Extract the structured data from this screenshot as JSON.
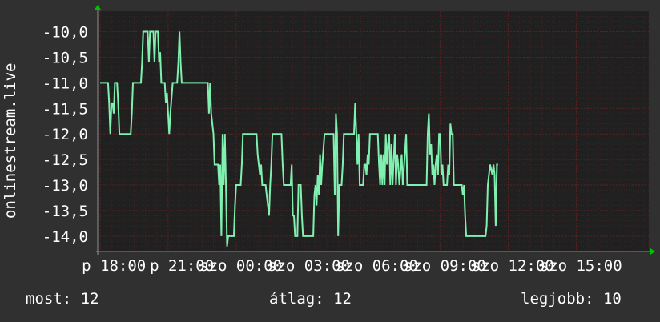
{
  "chart_data": {
    "type": "line",
    "ylabel": "onlinestream.live",
    "ylim": [
      -14.3,
      -9.6
    ],
    "y_ticks": [
      "-10,0",
      "-10,5",
      "-11,0",
      "-11,5",
      "-12,0",
      "-12,5",
      "-13,0",
      "-13,5",
      "-14,0"
    ],
    "y_tick_values": [
      -10,
      -10.5,
      -11,
      -11.5,
      -12,
      -12.5,
      -13,
      -13.5,
      -14
    ],
    "x_ticks": [
      "p 18:00",
      "p 21:00",
      "szo 00:00",
      "szo 03:00",
      "szo 06:00",
      "szo 09:00",
      "szo 12:00",
      "szo 15:00"
    ],
    "x_tick_hours": [
      0,
      3,
      6,
      9,
      12,
      15,
      18,
      21
    ],
    "xlim_hours": [
      0,
      24.2
    ],
    "grid": true,
    "colors": {
      "line": "#80f0b0",
      "background": "#303030",
      "plot_bg": "#202020",
      "grid": "#5a1f1f",
      "arrow": "#00c000"
    },
    "series": [
      {
        "values": [
          [
            0.0,
            -11.0
          ],
          [
            0.35,
            -11.0
          ],
          [
            0.4,
            -11.4
          ],
          [
            0.45,
            -12.0
          ],
          [
            0.5,
            -11.4
          ],
          [
            0.55,
            -11.4
          ],
          [
            0.6,
            -11.6
          ],
          [
            0.65,
            -11.0
          ],
          [
            0.75,
            -11.0
          ],
          [
            0.8,
            -11.4
          ],
          [
            0.85,
            -12.0
          ],
          [
            1.35,
            -12.0
          ],
          [
            1.4,
            -11.6
          ],
          [
            1.45,
            -11.0
          ],
          [
            1.8,
            -11.0
          ],
          [
            1.85,
            -10.6
          ],
          [
            1.9,
            -10.0
          ],
          [
            2.1,
            -10.0
          ],
          [
            2.15,
            -10.6
          ],
          [
            2.2,
            -10.0
          ],
          [
            2.35,
            -10.0
          ],
          [
            2.4,
            -10.6
          ],
          [
            2.45,
            -10.0
          ],
          [
            2.55,
            -10.0
          ],
          [
            2.6,
            -10.6
          ],
          [
            2.65,
            -10.4
          ],
          [
            2.7,
            -11.0
          ],
          [
            2.85,
            -11.0
          ],
          [
            2.9,
            -11.4
          ],
          [
            2.95,
            -11.2
          ],
          [
            3.0,
            -11.6
          ],
          [
            3.05,
            -12.0
          ],
          [
            3.1,
            -11.6
          ],
          [
            3.2,
            -11.0
          ],
          [
            3.4,
            -11.0
          ],
          [
            3.45,
            -10.6
          ],
          [
            3.5,
            -10.0
          ],
          [
            3.55,
            -10.6
          ],
          [
            3.6,
            -11.0
          ],
          [
            4.75,
            -11.0
          ],
          [
            4.8,
            -11.6
          ],
          [
            4.85,
            -11.0
          ],
          [
            4.9,
            -11.6
          ],
          [
            5.0,
            -12.0
          ],
          [
            5.05,
            -12.6
          ],
          [
            5.2,
            -12.6
          ],
          [
            5.25,
            -13.0
          ],
          [
            5.3,
            -12.6
          ],
          [
            5.35,
            -14.0
          ],
          [
            5.4,
            -12.0
          ],
          [
            5.45,
            -13.0
          ],
          [
            5.5,
            -12.0
          ],
          [
            5.55,
            -13.0
          ],
          [
            5.6,
            -14.2
          ],
          [
            5.65,
            -14.0
          ],
          [
            5.9,
            -14.0
          ],
          [
            5.95,
            -13.4
          ],
          [
            6.0,
            -13.0
          ],
          [
            6.2,
            -13.0
          ],
          [
            6.25,
            -12.6
          ],
          [
            6.3,
            -12.0
          ],
          [
            6.9,
            -12.0
          ],
          [
            6.95,
            -12.4
          ],
          [
            7.0,
            -12.6
          ],
          [
            7.05,
            -12.8
          ],
          [
            7.1,
            -12.6
          ],
          [
            7.15,
            -13.0
          ],
          [
            7.3,
            -13.0
          ],
          [
            7.35,
            -13.2
          ],
          [
            7.4,
            -13.4
          ],
          [
            7.45,
            -13.6
          ],
          [
            7.5,
            -13.0
          ],
          [
            7.55,
            -12.6
          ],
          [
            7.6,
            -12.0
          ],
          [
            8.0,
            -12.0
          ],
          [
            8.05,
            -12.6
          ],
          [
            8.1,
            -13.0
          ],
          [
            8.4,
            -13.0
          ],
          [
            8.45,
            -12.6
          ],
          [
            8.5,
            -13.6
          ],
          [
            8.55,
            -13.6
          ],
          [
            8.6,
            -14.0
          ],
          [
            8.7,
            -14.0
          ],
          [
            8.75,
            -13.0
          ],
          [
            8.85,
            -13.0
          ],
          [
            8.9,
            -13.6
          ],
          [
            8.95,
            -14.0
          ],
          [
            9.4,
            -14.0
          ],
          [
            9.45,
            -13.2
          ],
          [
            9.5,
            -13.0
          ],
          [
            9.55,
            -13.4
          ],
          [
            9.6,
            -12.8
          ],
          [
            9.65,
            -13.2
          ],
          [
            9.7,
            -12.4
          ],
          [
            9.75,
            -13.0
          ],
          [
            9.8,
            -12.6
          ],
          [
            9.9,
            -12.0
          ],
          [
            10.3,
            -12.0
          ],
          [
            10.35,
            -13.2
          ],
          [
            10.4,
            -11.6
          ],
          [
            10.45,
            -12.0
          ],
          [
            10.5,
            -14.0
          ],
          [
            10.55,
            -13.0
          ],
          [
            10.65,
            -13.0
          ],
          [
            10.7,
            -12.6
          ],
          [
            10.75,
            -12.0
          ],
          [
            11.2,
            -12.0
          ],
          [
            11.25,
            -11.4
          ],
          [
            11.3,
            -12.0
          ],
          [
            11.35,
            -12.6
          ],
          [
            11.4,
            -12.0
          ],
          [
            11.45,
            -13.0
          ],
          [
            11.6,
            -13.0
          ],
          [
            11.65,
            -12.6
          ],
          [
            11.7,
            -12.6
          ],
          [
            11.75,
            -12.8
          ],
          [
            11.8,
            -12.4
          ],
          [
            11.85,
            -12.6
          ],
          [
            11.9,
            -12.0
          ],
          [
            12.25,
            -12.0
          ],
          [
            12.3,
            -12.6
          ],
          [
            12.35,
            -13.0
          ],
          [
            12.4,
            -12.4
          ],
          [
            12.45,
            -13.0
          ],
          [
            12.5,
            -12.4
          ],
          [
            12.55,
            -13.0
          ],
          [
            12.6,
            -12.0
          ],
          [
            12.65,
            -12.6
          ],
          [
            12.7,
            -12.2
          ],
          [
            12.75,
            -12.0
          ],
          [
            12.8,
            -13.0
          ],
          [
            12.85,
            -12.2
          ],
          [
            12.9,
            -13.0
          ],
          [
            13.0,
            -12.0
          ],
          [
            13.05,
            -13.0
          ],
          [
            13.1,
            -12.4
          ],
          [
            13.15,
            -12.6
          ],
          [
            13.2,
            -13.0
          ],
          [
            13.3,
            -12.4
          ],
          [
            13.35,
            -13.0
          ],
          [
            13.5,
            -12.0
          ],
          [
            13.55,
            -13.0
          ],
          [
            14.4,
            -13.0
          ],
          [
            14.45,
            -12.0
          ],
          [
            14.5,
            -11.6
          ],
          [
            14.55,
            -12.4
          ],
          [
            14.6,
            -12.2
          ],
          [
            14.65,
            -12.8
          ],
          [
            14.7,
            -12.6
          ],
          [
            14.75,
            -13.0
          ],
          [
            14.8,
            -12.6
          ],
          [
            14.85,
            -12.4
          ],
          [
            14.9,
            -12.8
          ],
          [
            14.95,
            -12.0
          ],
          [
            15.0,
            -12.0
          ],
          [
            15.05,
            -12.8
          ],
          [
            15.1,
            -12.6
          ],
          [
            15.15,
            -13.0
          ],
          [
            15.3,
            -13.0
          ],
          [
            15.35,
            -12.6
          ],
          [
            15.4,
            -12.8
          ],
          [
            15.45,
            -11.8
          ],
          [
            15.5,
            -12.0
          ],
          [
            15.55,
            -12.0
          ],
          [
            15.6,
            -13.0
          ],
          [
            15.95,
            -13.0
          ],
          [
            16.0,
            -13.2
          ],
          [
            16.05,
            -13.0
          ],
          [
            16.1,
            -13.6
          ],
          [
            16.15,
            -14.0
          ],
          [
            17.0,
            -14.0
          ],
          [
            17.05,
            -13.8
          ],
          [
            17.1,
            -13.0
          ],
          [
            17.2,
            -12.6
          ],
          [
            17.3,
            -12.8
          ],
          [
            17.35,
            -12.6
          ],
          [
            17.4,
            -12.8
          ],
          [
            17.45,
            -13.8
          ],
          [
            17.5,
            -12.6
          ],
          [
            17.55,
            -12.6
          ]
        ]
      }
    ]
  },
  "footer": {
    "current": "most: 12",
    "average": "átlag: 12",
    "best": "legjobb: 10"
  }
}
